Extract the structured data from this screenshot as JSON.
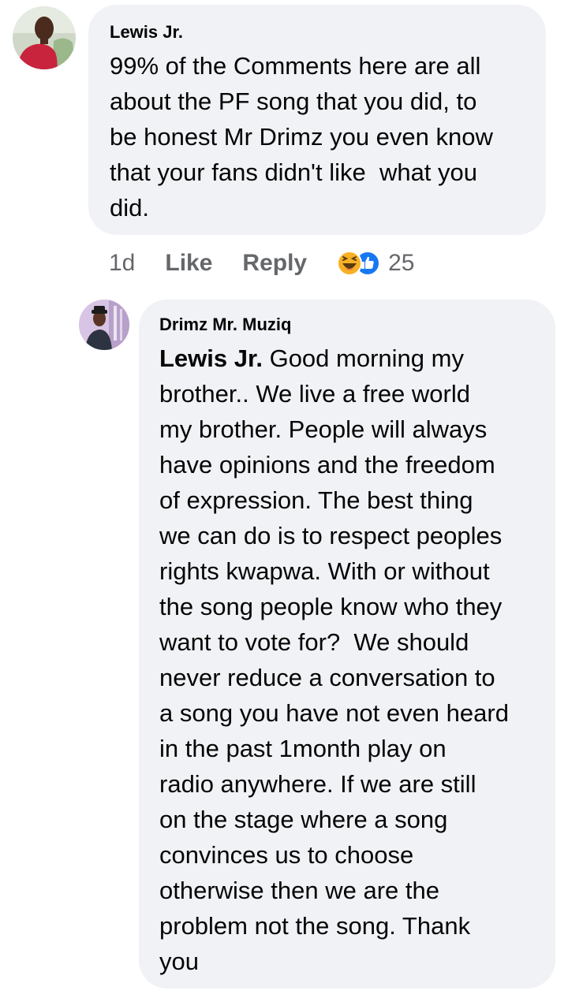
{
  "comments": [
    {
      "author": "Lewis Jr.",
      "text": "99% of the Comments here are all\nabout the PF song that you did, to\nbe honest Mr Drimz you even know\nthat your fans didn't like  what you\ndid.",
      "time": "1d",
      "like_label": "Like",
      "reply_label": "Reply",
      "reaction_count": "25",
      "reactions": [
        "haha-icon",
        "like-icon"
      ]
    }
  ],
  "reply": {
    "author": "Drimz Mr. Muziq",
    "mention": "Lewis Jr.",
    "text_first_line": " Good morning my",
    "text": "brother.. We live a free world\nmy brother. People will always\nhave opinions and the freedom\nof expression. The best thing\nwe can do is to respect peoples\nrights kwapwa. With or without\nthe song people know who they\nwant to vote for?  We should\nnever reduce a conversation to\na song you have not even heard\nin the past 1month play on\nradio anywhere. If we are still\non the stage where a song\nconvinces us to choose\notherwise then we are the\nproblem not the song. Thank\nyou"
  },
  "colors": {
    "bubble": "#f0f2f5",
    "text": "#050505",
    "secondary": "#65676b",
    "like_blue": "#1877f2",
    "haha_yellow": "#f7b125"
  }
}
